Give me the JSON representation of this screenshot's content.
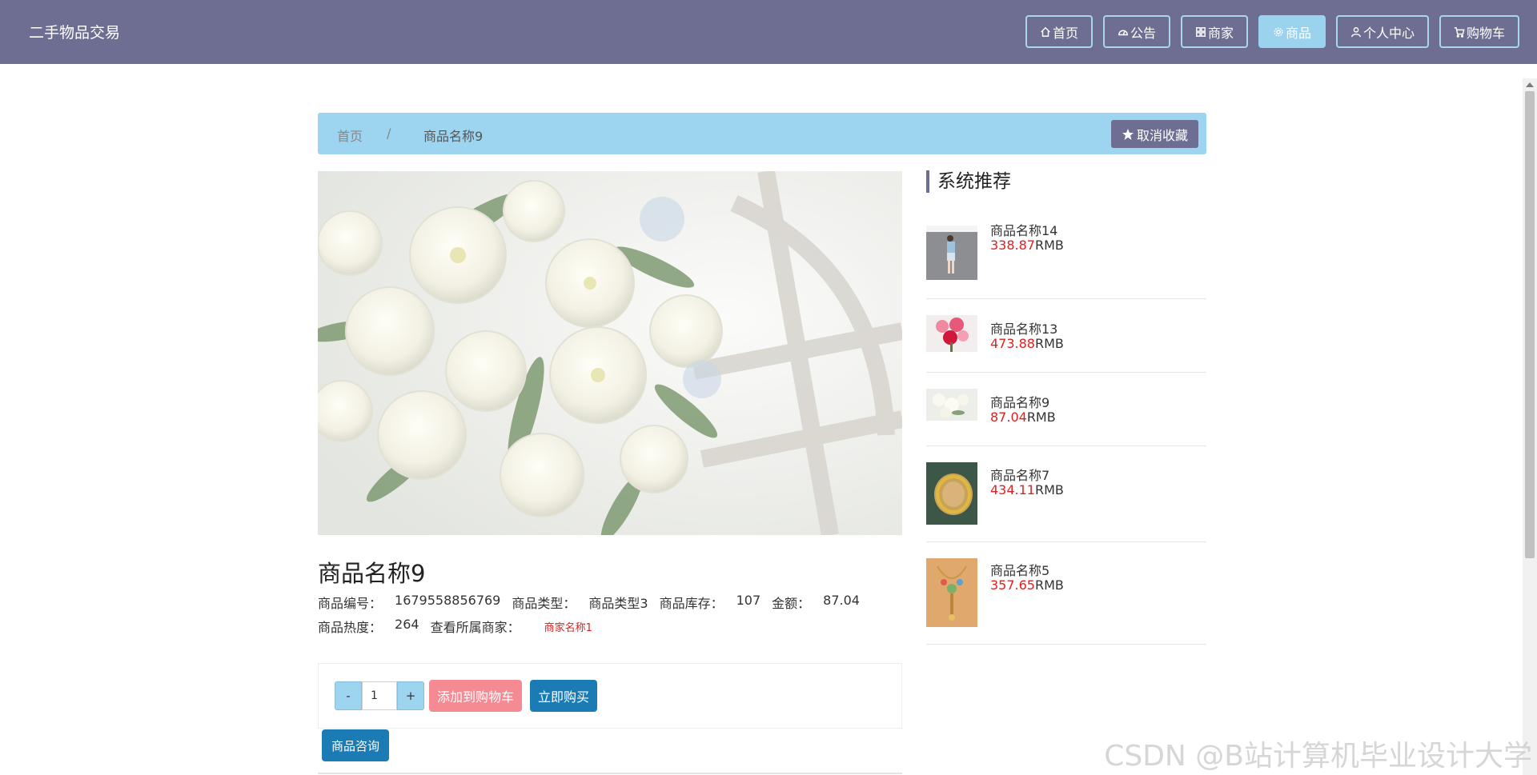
{
  "header": {
    "brand": "二手物品交易",
    "nav": [
      {
        "label": "首页",
        "icon": "home-icon"
      },
      {
        "label": "公告",
        "icon": "dashboard-icon"
      },
      {
        "label": "商家",
        "icon": "grid-icon"
      },
      {
        "label": "商品",
        "icon": "gear-icon",
        "active": true
      },
      {
        "label": "个人中心",
        "icon": "user-icon"
      },
      {
        "label": "购物车",
        "icon": "cart-icon"
      }
    ]
  },
  "breadcrumb": {
    "home": "首页",
    "separator": "/",
    "current": "商品名称9",
    "favorite_button": "取消收藏"
  },
  "product": {
    "title": "商品名称9",
    "code_label": "商品编号：",
    "code": "1679558856769",
    "type_label": "商品类型：",
    "type": "商品类型3",
    "stock_label": "商品库存：",
    "stock": "107",
    "price_label": "金额：",
    "price": "87.04",
    "heat_label": "商品热度：",
    "heat": "264",
    "merchant_label": "查看所属商家：",
    "merchant": "商家名称1"
  },
  "cart": {
    "minus": "-",
    "plus": "+",
    "quantity": "1",
    "add_to_cart": "添加到购物车",
    "buy_now": "立即购买",
    "consult": "商品咨询"
  },
  "recommend": {
    "title": "系统推荐",
    "items": [
      {
        "name": "商品名称14",
        "price": "338.87",
        "unit": "RMB"
      },
      {
        "name": "商品名称13",
        "price": "473.88",
        "unit": "RMB"
      },
      {
        "name": "商品名称9",
        "price": "87.04",
        "unit": "RMB"
      },
      {
        "name": "商品名称7",
        "price": "434.11",
        "unit": "RMB"
      },
      {
        "name": "商品名称5",
        "price": "357.65",
        "unit": "RMB"
      }
    ]
  },
  "watermark": "CSDN @B站计算机毕业设计大学",
  "colors": {
    "header": "#6e6e92",
    "accent": "#9dd4ef",
    "primary": "#1b7cb5",
    "danger": "#f58a92",
    "price": "#e02020"
  }
}
